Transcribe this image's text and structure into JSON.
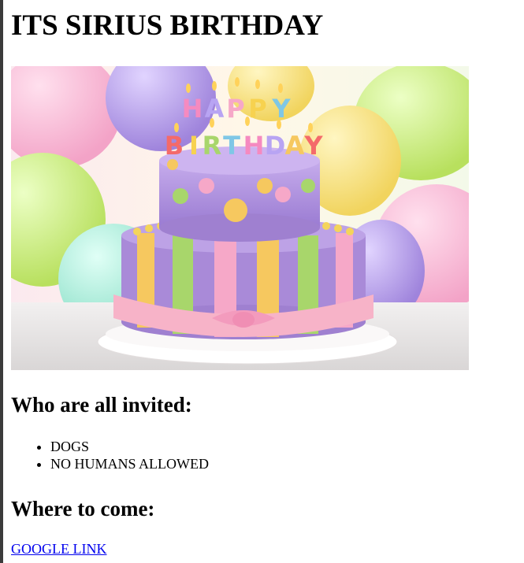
{
  "page": {
    "title": "ITS SIRIUS BIRTHDAY",
    "hero_image": {
      "alt": "Birthday cake",
      "cake_topper_text": "HAPPY BIRTHDAY",
      "colors": {
        "background_balloons": [
          "#f7b3d4",
          "#c8f07a",
          "#a78be0",
          "#f9e27a",
          "#8ee6d0"
        ],
        "cake_top": "#b394d9",
        "stripes": [
          "#f6c85f",
          "#a8d66b",
          "#f6a8c8"
        ],
        "ribbon": "#f7b3c8"
      }
    },
    "invited": {
      "heading": "Who are all invited:",
      "items": [
        "DOGS",
        "NO HUMANS ALLOWED"
      ]
    },
    "location": {
      "heading": "Where to come:",
      "link_text": "GOOGLE LINK"
    }
  }
}
